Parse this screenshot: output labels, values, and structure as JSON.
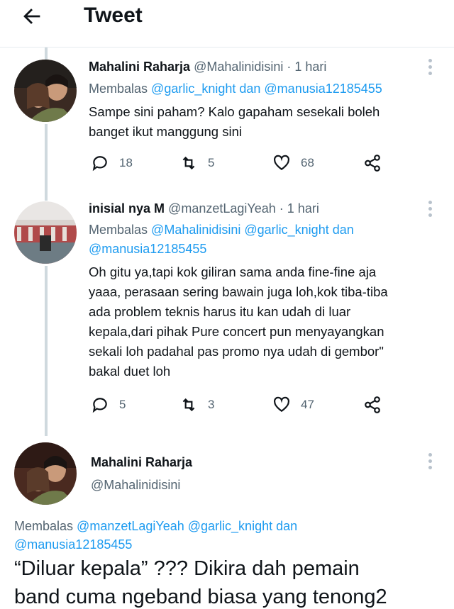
{
  "header": {
    "back_icon": "arrow-left-icon",
    "title": "Tweet"
  },
  "tweets": [
    {
      "display_name": "Mahalini Raharja",
      "handle": "@Mahalinidisini",
      "time": "· 1 hari",
      "reply_prefix": "Membalas",
      "reply_mentions_1": "@garlic_knight dan @manusia12185455",
      "body": [
        "Sampe sini paham? Kalo gapaham sesekali boleh",
        "banget ikut manggung sini"
      ],
      "replies": "18",
      "retweets": "5",
      "likes": "68"
    },
    {
      "display_name": "inisial nya M",
      "handle": "@manzetLagiYeah",
      "time": "· 1 hari",
      "reply_prefix": "Membalas",
      "reply_mentions_1": "@Mahalinidisini @garlic_knight dan",
      "reply_mentions_2": "@manusia12185455",
      "body": [
        "Oh gitu ya,tapi kok giliran sama anda fine-fine aja",
        "yaaa, perasaan sering bawain juga loh,kok tiba-tiba",
        "ada problem teknis harus itu kan udah di luar",
        "kepala,dari pihak Pure concert pun menyayangkan",
        "sekali loh padahal pas promo nya udah di gembor\"",
        "bakal duet loh"
      ],
      "replies": "5",
      "retweets": "3",
      "likes": "47"
    }
  ],
  "main_tweet": {
    "display_name": "Mahalini Raharja",
    "handle": "@Mahalinidisini",
    "reply_prefix": "Membalas",
    "reply_mentions_1": "@manzetLagiYeah @garlic_knight dan",
    "reply_mentions_2": "@manusia12185455",
    "body": [
      "“Diluar kepala” ??? Dikira dah pemain",
      "band cuma ngeband biasa yang tenong2"
    ]
  },
  "icons": {
    "reply": "reply-icon",
    "retweet": "retweet-icon",
    "like": "heart-icon",
    "share": "share-icon",
    "more": "more-vertical-icon"
  },
  "colors": {
    "link": "#1d9bf0",
    "muted": "#536471",
    "text": "#0f1419",
    "thread_line": "#cfd9de"
  }
}
